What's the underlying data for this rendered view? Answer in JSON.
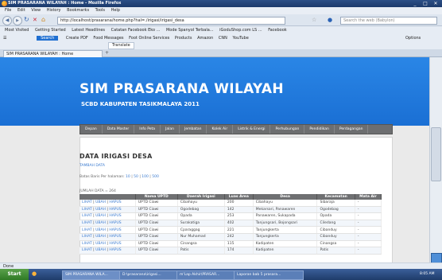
{
  "window": {
    "title": "SIM PRASARANA WILAYAH : Home - Mozilla Firefox",
    "controls": [
      "_",
      "□",
      "✕"
    ]
  },
  "menu": [
    "File",
    "Edit",
    "View",
    "History",
    "Bookmarks",
    "Tools",
    "Help"
  ],
  "nav": {
    "url": "http://localhost/prasarana/home.php?hal=./irigasi/irigasi_desa",
    "search_placeholder": "Search the web (Babylon)"
  },
  "bookmarks": [
    "Most Visited",
    "Getting Started",
    "Latest Headlines",
    "Catatan Facebook Eko ...",
    "Mode Spanyol Terbala...",
    "iGoduShop.com LS ...",
    "Facebook"
  ],
  "toolbar2": {
    "search_label": "Search",
    "items": [
      "Create PDF",
      "Food Messages",
      "Foot Online Services",
      "Products",
      "Amazon",
      "CNN",
      "YouTube"
    ],
    "options": "Options"
  },
  "toolbar3": {
    "translate": "Translate"
  },
  "tabs": [
    {
      "label": "SIM PRASARANA WILAYAH : Home"
    }
  ],
  "site": {
    "title": "SIM PRASARANA WILAYAH",
    "subtitle": "SCBD KABUPATEN TASIKMALAYA 2011"
  },
  "main_nav": [
    "Depan",
    "Data Master",
    "Info Peta",
    "Jalan",
    "Jembatan",
    "Kolek Air",
    "Listrik & Energi",
    "Perhubungan",
    "Pendidikan",
    "Perdagangan"
  ],
  "page": {
    "heading": "DATA IRIGASI DESA",
    "add_link": "TAMBAH DATA",
    "per_page_label": "Batas Baris Per halaman:",
    "per_page_options": [
      "10",
      "50",
      "100",
      "500"
    ],
    "count_label": "JUMLAH DATA = 264"
  },
  "table": {
    "headers": [
      "",
      "Nama UPTD",
      "Daerah Irigasi",
      "Luas Area",
      "Desa",
      "Kecamatan",
      "Mata Air"
    ],
    "action_labels": [
      "LIHAT",
      "UBAH",
      "HAPUS"
    ],
    "rows": [
      [
        "UPTD Ciawi",
        "Cibahayu",
        "200",
        "Cibahayu",
        "Sibaraja",
        "-"
      ],
      [
        "UPTD Ciawi",
        "Ogodebag",
        "142",
        "Mekarsari, Panawaren",
        "Ogodebag",
        "-"
      ],
      [
        "UPTD Ciawi",
        "Opada",
        "253",
        "Panawaren, Sukapada",
        "Opada",
        "-"
      ],
      [
        "UPTD Ciawi",
        "Surakatiga",
        "402",
        "Tanjungsari, Bojongsari",
        "Ciledang",
        "-"
      ],
      [
        "UPTD Ciawi",
        "Cparaggag",
        "221",
        "Tanjungkerta",
        "Cibanduy",
        "-"
      ],
      [
        "UPTD Ciawi",
        "Nur Muhamad",
        "242",
        "Tanjungkerta",
        "Cibanduy",
        "-"
      ],
      [
        "UPTD Ciawi",
        "Cinangsa",
        "115",
        "Kadipaten",
        "Cinangsa",
        "-"
      ],
      [
        "UPTD Ciawi",
        "Patis",
        "174",
        "Kadipaten",
        "Patis",
        "-"
      ]
    ]
  },
  "status": {
    "text": "Done"
  },
  "taskbar": {
    "start": "Start",
    "items": [
      "SIM PRASARANA WILA...",
      "D:\\prasarana\\irigasi...",
      "m'Lap Akhir\\PRASAR...",
      "Laporan bab 5 prasara..."
    ],
    "clock": "8:05 AM"
  }
}
